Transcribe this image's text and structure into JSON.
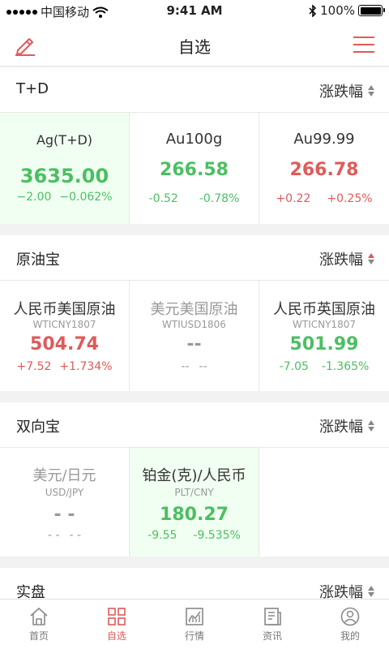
{
  "status": {
    "carrier": "中国移动",
    "time": "9:41 AM",
    "battery": "100%"
  },
  "nav": {
    "title": "自选"
  },
  "sections": [
    {
      "title": "T+D",
      "sort_label": "涨跌幅",
      "cells": [
        {
          "name": "Ag(T+D)",
          "price": "3635.00",
          "chg": "−2.00",
          "pct": "−0.062%"
        },
        {
          "name": "Au100g",
          "price": "266.58",
          "chg": "-0.52",
          "pct": "-0.78%"
        },
        {
          "name": "Au99.99",
          "price": "266.78",
          "chg": "+0.22",
          "pct": "+0.25%"
        }
      ]
    },
    {
      "title": "原油宝",
      "sort_label": "涨跌幅",
      "cells": [
        {
          "name": "人民币美国原油",
          "code": "WTICNY1807",
          "price": "504.74",
          "chg": "+7.52",
          "pct": "+1.734%"
        },
        {
          "name": "美元美国原油",
          "code": "WTIUSD1806",
          "price": "--",
          "chg": "--",
          "pct": "--"
        },
        {
          "name": "人民币英国原油",
          "code": "WTICNY1807",
          "price": "501.99",
          "chg": "-7.05",
          "pct": "-1.365%"
        }
      ]
    },
    {
      "title": "双向宝",
      "sort_label": "涨跌幅",
      "cells": [
        {
          "name": "美元/日元",
          "code": "USD/JPY",
          "price": "- -",
          "chg": "- -",
          "pct": "- -"
        },
        {
          "name": "铂金(克)/人民币",
          "code": "PLT/CNY",
          "price": "180.27",
          "chg": "-9.55",
          "pct": "-9.535%"
        }
      ]
    },
    {
      "title": "实盘",
      "sort_label": "涨跌幅"
    }
  ],
  "tabs": [
    {
      "label": "首页",
      "icon": "home-icon"
    },
    {
      "label": "自选",
      "icon": "grid-icon"
    },
    {
      "label": "行情",
      "icon": "chart-icon"
    },
    {
      "label": "资讯",
      "icon": "news-icon"
    },
    {
      "label": "我的",
      "icon": "user-icon"
    }
  ],
  "colors": {
    "accent": "#e05a5a",
    "rise": "#e05a5a",
    "fall": "#4cbf62",
    "highlight_bg": "#f0fff1"
  }
}
